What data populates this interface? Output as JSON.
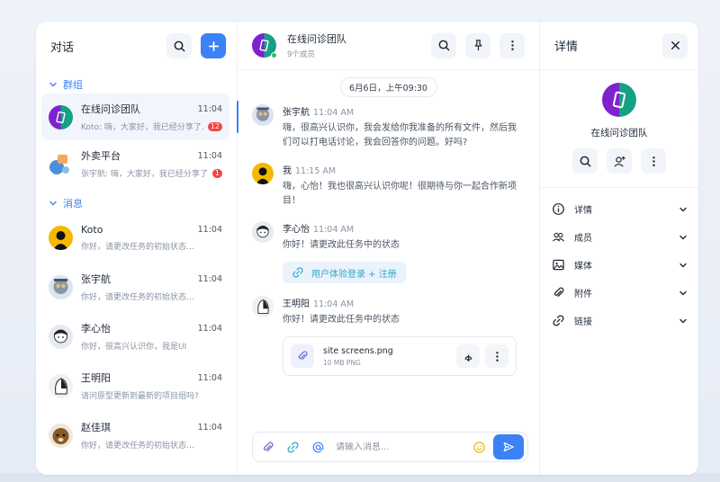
{
  "colors": {
    "accent": "#3b82f6",
    "danger": "#ef4444",
    "link": "#2fa7c9",
    "group_avatar_green": "#16a085",
    "group_avatar_purple": "#7e22ce"
  },
  "conversations_panel": {
    "title": "对话",
    "search_icon": "search-icon",
    "new_icon": "plus-icon",
    "groups_label": "群组",
    "messages_label": "消息",
    "groups": [
      {
        "name": "在线问诊团队",
        "time": "11:04",
        "preview": "Koto: 嗨，大家好，我已经分享了…",
        "badge": "12",
        "active": true
      },
      {
        "name": "外卖平台",
        "time": "11:04",
        "preview": "张宇航: 嗨，大家好，我已经分享了…",
        "badge": "1",
        "active": false
      }
    ],
    "direct": [
      {
        "name": "Koto",
        "time": "11:04",
        "preview": "你好，请更改任务的初始状态…"
      },
      {
        "name": "张宇航",
        "time": "11:04",
        "preview": "你好，请更改任务的初始状态…"
      },
      {
        "name": "李心怡",
        "time": "11:04",
        "preview": "你好，很高兴认识你，我是UI"
      },
      {
        "name": "王明阳",
        "time": "11:04",
        "preview": "请问原型更新到最新的项目组吗?"
      },
      {
        "name": "赵佳琪",
        "time": "11:04",
        "preview": "你好，请更改任务的初始状态…"
      }
    ]
  },
  "chat": {
    "group_name": "在线问诊团队",
    "member_count": "9个成员",
    "date_divider": "6月6日，上午09:30",
    "messages": [
      {
        "sender": "张宇航",
        "time": "11:04 AM",
        "text": "嗨，很高兴认识你，我会发给你我准备的所有文件，然后我们可以打电话讨论，我会回答你的问题。好吗?"
      },
      {
        "sender": "我",
        "time": "11:15 AM",
        "text": "嗨，心怡！我也很高兴认识你呢！很期待与你一起合作新项目！"
      },
      {
        "sender": "李心怡",
        "time": "11:04 AM",
        "text": "你好！请更改此任务中的状态",
        "link": "用户体验登录 + 注册"
      },
      {
        "sender": "王明阳",
        "time": "11:04 AM",
        "text": "你好！请更改此任务中的状态",
        "file": {
          "name": "site screens.png",
          "size": "10 MB PNG"
        }
      }
    ],
    "composer": {
      "placeholder": "请输入消息..."
    }
  },
  "details_panel": {
    "title": "详情",
    "group_name": "在线问诊团队",
    "sections": [
      {
        "label": "详情",
        "icon": "info-icon"
      },
      {
        "label": "成员",
        "icon": "members-icon"
      },
      {
        "label": "媒体",
        "icon": "image-icon"
      },
      {
        "label": "附件",
        "icon": "paperclip-icon"
      },
      {
        "label": "链接",
        "icon": "link-icon"
      }
    ]
  }
}
